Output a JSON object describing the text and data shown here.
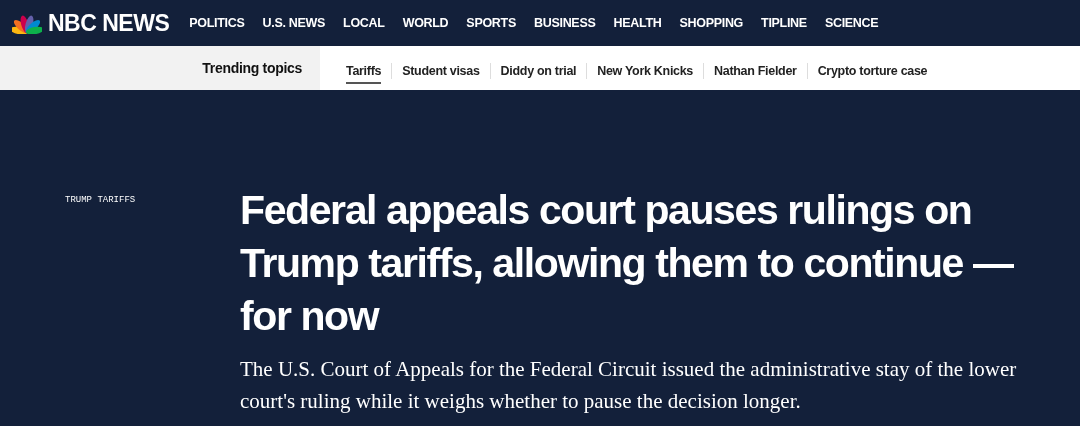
{
  "header": {
    "logo_text": "NBC NEWS",
    "nav": [
      "POLITICS",
      "U.S. NEWS",
      "LOCAL",
      "WORLD",
      "SPORTS",
      "BUSINESS",
      "HEALTH",
      "SHOPPING",
      "TIPLINE",
      "SCIENCE"
    ]
  },
  "trending": {
    "label": "Trending topics",
    "topics": [
      {
        "label": "Tariffs",
        "selected": true
      },
      {
        "label": "Student visas",
        "selected": false
      },
      {
        "label": "Diddy on trial",
        "selected": false
      },
      {
        "label": "New York Knicks",
        "selected": false
      },
      {
        "label": "Nathan Fielder",
        "selected": false
      },
      {
        "label": "Crypto torture case",
        "selected": false
      }
    ]
  },
  "article": {
    "eyebrow": "TRUMP TARIFFS",
    "headline": "Federal appeals court pauses rulings on Trump tariffs, allowing them to continue — for now",
    "dek": "The U.S. Court of Appeals for the Federal Circuit issued the administrative stay of the lower court's ruling while it weighs whether to pause the decision longer."
  }
}
